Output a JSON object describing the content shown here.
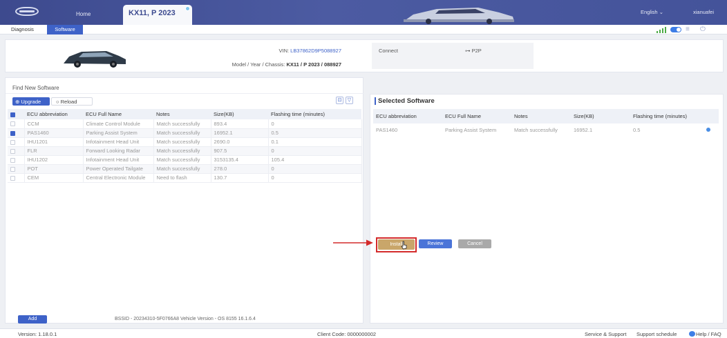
{
  "header": {
    "home_tab": "Home",
    "vehicle_tab": "KX11, P 2023",
    "language": "English",
    "user": "xianuafei"
  },
  "subnav": {
    "tabs": [
      {
        "label": "Diagnosis",
        "active": false
      },
      {
        "label": "Software",
        "active": true
      }
    ]
  },
  "vehicle": {
    "vin_label": "VIN:",
    "vin": "LB37862D9P5088927",
    "model_label": "Model / Year / Chassis:",
    "model": "KX11 / P 2023 / 088927",
    "connect_label": "Connect",
    "connect_value": "P2P"
  },
  "find_panel": {
    "title": "Find New Software",
    "upgrade_label": "Upgrade",
    "reload_label": "Reload",
    "columns": [
      "ECU abbreviation",
      "ECU Full Name",
      "Notes",
      "Size(KB)",
      "Flashing time (minutes)"
    ],
    "rows": [
      {
        "checked": false,
        "abbr": "CCM",
        "full": "Climate Control Module",
        "notes": "Match successfully",
        "size": "893.4",
        "time": "0"
      },
      {
        "checked": true,
        "abbr": "PAS1460",
        "full": "Parking Assist System",
        "notes": "Match successfully",
        "size": "16952.1",
        "time": "0.5"
      },
      {
        "checked": false,
        "abbr": "IHU1201",
        "full": "Infotainment Head Unit",
        "notes": "Match successfully",
        "size": "2690.0",
        "time": "0.1"
      },
      {
        "checked": false,
        "abbr": "FLR",
        "full": "Forward Looking Radar",
        "notes": "Match successfully",
        "size": "907.5",
        "time": "0"
      },
      {
        "checked": false,
        "abbr": "IHU1202",
        "full": "Infotainment Head Unit",
        "notes": "Match successfully",
        "size": "3153135.4",
        "time": "105.4"
      },
      {
        "checked": false,
        "abbr": "POT",
        "full": "Power Operated Tailgate",
        "notes": "Match successfully",
        "size": "278.0",
        "time": "0"
      },
      {
        "checked": false,
        "abbr": "CEM",
        "full": "Central Electronic Module",
        "notes": "Need to flash",
        "size": "130.7",
        "time": "0"
      }
    ],
    "add_label": "Add",
    "bssid_text": "BSSID - 20234310-5F0766A8 Vehicle Version - OS 8155 16.1.6.4"
  },
  "selected_panel": {
    "title": "Selected Software",
    "columns": [
      "ECU abbreviation",
      "ECU Full Name",
      "Notes",
      "Size(KB)",
      "Flashing time (minutes)"
    ],
    "rows": [
      {
        "abbr": "PAS1460",
        "full": "Parking Assist System",
        "notes": "Match successfully",
        "size": "16952.1",
        "time": "0.5"
      }
    ],
    "install_label": "Install",
    "review_label": "Review",
    "cancel_label": "Cancel"
  },
  "footer": {
    "version": "Version: 1.18.0.1",
    "client_code": "Client Code: 0000000002",
    "service_support": "Service & Support",
    "support_schedule": "Support schedule",
    "help_faq": "Help / FAQ"
  },
  "colors": {
    "header_bg": "#44539a",
    "accent": "#3e62c8",
    "install_button": "#c9a66a",
    "highlight": "#d42a2a",
    "status_dot": "#4a8ee5"
  },
  "icons": [
    "logo-icon",
    "signal-icon",
    "toggle-icon",
    "menu-icon",
    "power-icon",
    "upgrade-icon",
    "reload-icon",
    "export-icon",
    "filter-icon",
    "connection-icon",
    "cursor-icon",
    "arrow-icon",
    "help-icon"
  ]
}
